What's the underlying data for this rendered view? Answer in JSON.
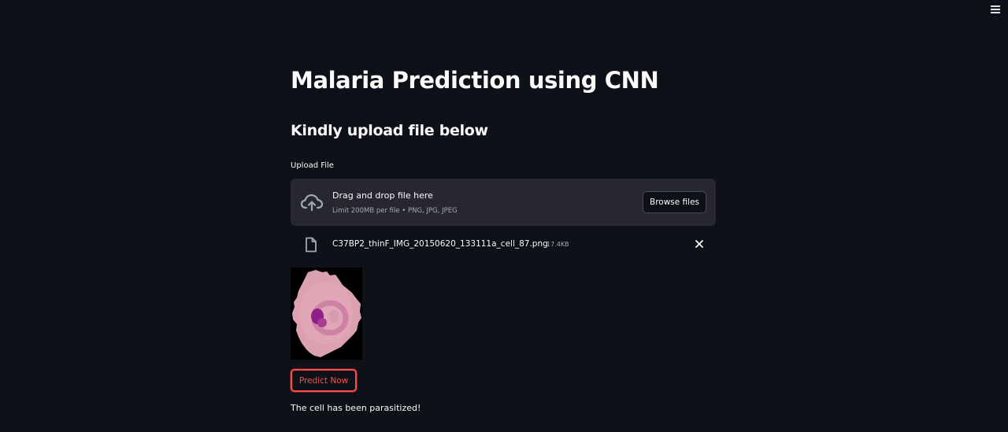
{
  "app": {
    "title": "Malaria Prediction using CNN",
    "subtitle": "Kindly upload file below"
  },
  "uploader": {
    "label": "Upload File",
    "drop_text": "Drag and drop file here",
    "limit_text": "Limit 200MB per file • PNG, JPG, JPEG",
    "browse_label": "Browse files"
  },
  "uploaded_file": {
    "name": "C37BP2_thinF_IMG_20150620_133111a_cell_87.png",
    "size": "17.4KB"
  },
  "actions": {
    "predict_label": "Predict Now"
  },
  "result": {
    "text": "The cell has been parasitized!"
  },
  "icons": {
    "menu": "hamburger-menu-icon",
    "upload": "cloud-upload-icon",
    "file": "file-icon",
    "remove": "close-icon"
  },
  "colors": {
    "background": "#0e1117",
    "panel": "#262730",
    "text": "#fafafa",
    "muted": "#a3a8b4",
    "accent": "#ff4b4b"
  }
}
